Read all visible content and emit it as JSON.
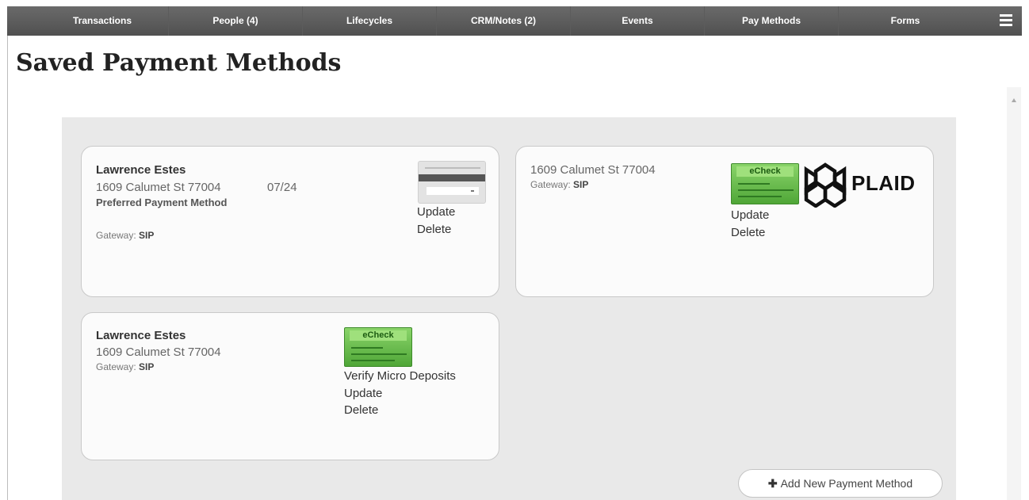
{
  "nav": {
    "items": [
      "Transactions",
      "People (4)",
      "Lifecycles",
      "CRM/Notes (2)",
      "Events",
      "Pay Methods",
      "Forms"
    ]
  },
  "page": {
    "title": "Saved Payment Methods"
  },
  "cards": [
    {
      "name": "Lawrence Estes",
      "address": "1609 Calumet St 77004",
      "expiry": "07/24",
      "preferred": "Preferred Payment Method",
      "gateway_label": "Gateway:",
      "gateway_value": "SIP",
      "update": "Update",
      "delete": "Delete"
    },
    {
      "address": "1609 Calumet St 77004",
      "gateway_label": "Gateway:",
      "gateway_value": "SIP",
      "echeck_label": "eCheck",
      "plaid": "PLAID",
      "update": "Update",
      "delete": "Delete"
    },
    {
      "name": "Lawrence Estes",
      "address": "1609 Calumet St 77004",
      "gateway_label": "Gateway:",
      "gateway_value": "SIP",
      "echeck_label": "eCheck",
      "verify": "Verify Micro Deposits",
      "update": "Update",
      "delete": "Delete"
    }
  ],
  "add_button": {
    "icon": "plus-icon",
    "label": "Add New Payment Method"
  },
  "colors": {
    "navbar": "#5a5a5a",
    "container": "#e9e9e9",
    "echeck_green": "#5fb845"
  }
}
